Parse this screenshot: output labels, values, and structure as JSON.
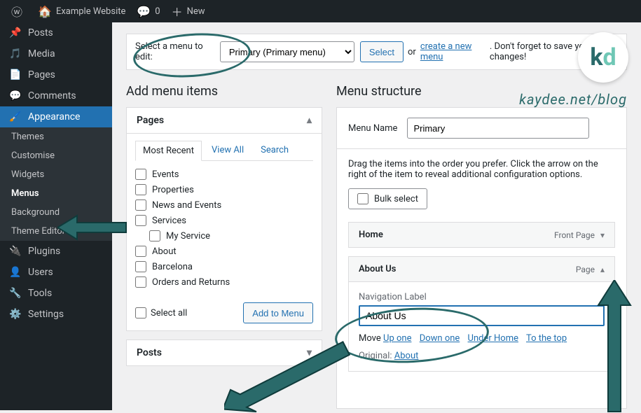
{
  "adminbar": {
    "site_title": "Example Website",
    "comments_count": "0",
    "new_label": "New"
  },
  "sidebar": {
    "items": [
      {
        "label": "Posts",
        "icon": "pin-icon"
      },
      {
        "label": "Media",
        "icon": "media-icon"
      },
      {
        "label": "Pages",
        "icon": "page-icon"
      },
      {
        "label": "Comments",
        "icon": "comment-icon"
      },
      {
        "label": "Appearance",
        "icon": "brush-icon",
        "current": true
      },
      {
        "label": "Plugins",
        "icon": "plug-icon"
      },
      {
        "label": "Users",
        "icon": "user-icon"
      },
      {
        "label": "Tools",
        "icon": "wrench-icon"
      },
      {
        "label": "Settings",
        "icon": "settings-icon"
      }
    ],
    "submenu": [
      {
        "label": "Themes"
      },
      {
        "label": "Customise"
      },
      {
        "label": "Widgets"
      },
      {
        "label": "Menus",
        "current": true
      },
      {
        "label": "Background"
      },
      {
        "label": "Theme Editor"
      }
    ]
  },
  "menubar": {
    "select_label": "Select a menu to edit:",
    "selected": "Primary (Primary menu)",
    "select_btn": "Select",
    "or": "or",
    "create_link": "create a new menu",
    "reminder": ". Don't forget to save your changes!"
  },
  "add_items": {
    "heading": "Add menu items",
    "pages_title": "Pages",
    "tabs": {
      "recent": "Most Recent",
      "all": "View All",
      "search": "Search"
    },
    "pages": [
      "Events",
      "Properties",
      "News and Events",
      "Services",
      "My Service",
      "About",
      "Barcelona",
      "Orders and Returns"
    ],
    "select_all": "Select all",
    "add_btn": "Add to Menu",
    "posts_title": "Posts"
  },
  "structure": {
    "heading": "Menu structure",
    "name_label": "Menu Name",
    "name_value": "Primary",
    "instructions": "Drag the items into the order you prefer. Click the arrow on the right of the item to reveal additional configuration options.",
    "bulk_label": "Bulk select",
    "items": [
      {
        "title": "Home",
        "type": "Front Page",
        "expanded": false
      },
      {
        "title": "About Us",
        "type": "Page",
        "expanded": true
      }
    ],
    "settings": {
      "nav_label_text": "Navigation Label",
      "nav_label_value": "About Us",
      "move_label": "Move",
      "move_links": [
        "Up one",
        "Down one",
        "Under Home",
        "To the top"
      ],
      "original_label": "Original:",
      "original_link": "About"
    }
  },
  "watermark": "kaydee.net/blog"
}
